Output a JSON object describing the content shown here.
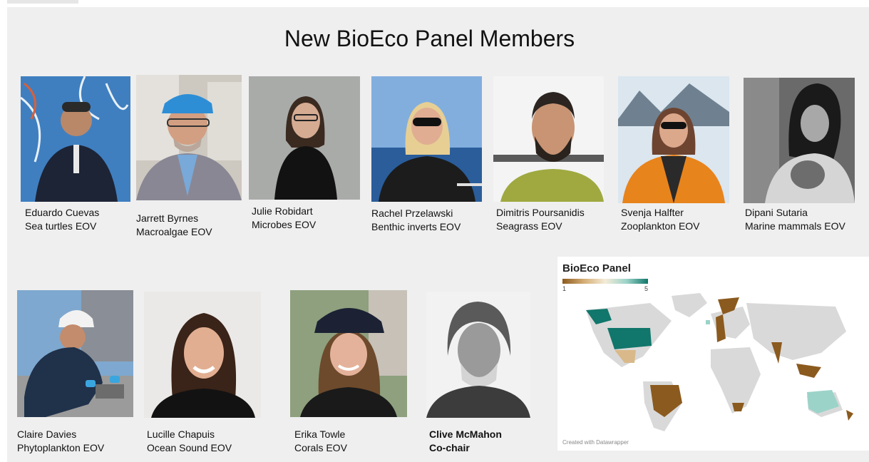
{
  "slide": {
    "title": "New BioEco Panel Members"
  },
  "members": [
    {
      "name": "Eduardo Cuevas",
      "role": "Sea turtles EOV"
    },
    {
      "name": "Jarrett Byrnes",
      "role": "Macroalgae EOV"
    },
    {
      "name": "Julie Robidart",
      "role": "Microbes EOV"
    },
    {
      "name": "Rachel Przelawski",
      "role": "Benthic inverts  EOV"
    },
    {
      "name": "Dimitris Poursanidis",
      "role": "Seagrass  EOV"
    },
    {
      "name": "Svenja Halfter",
      "role": "Zooplankton  EOV"
    },
    {
      "name": "Dipani Sutaria",
      "role": "Marine mammals  EOV"
    },
    {
      "name": "Claire Davies",
      "role": "Phytoplankton EOV"
    },
    {
      "name": "Lucille Chapuis",
      "role": "Ocean Sound EOV"
    },
    {
      "name": "Erika Towle",
      "role": "Corals EOV"
    },
    {
      "name": "Clive McMahon",
      "role": "Co-chair"
    }
  ],
  "map": {
    "title": "BioEco Panel",
    "legend_min": "1",
    "legend_max": "5",
    "credit": "Created with Datawrapper",
    "colors": {
      "level_1": "#8b5a1e",
      "level_2": "#d9b98a",
      "level_4": "#9bd3c9",
      "level_5": "#11766b",
      "no_data": "#d9d9d9"
    }
  }
}
